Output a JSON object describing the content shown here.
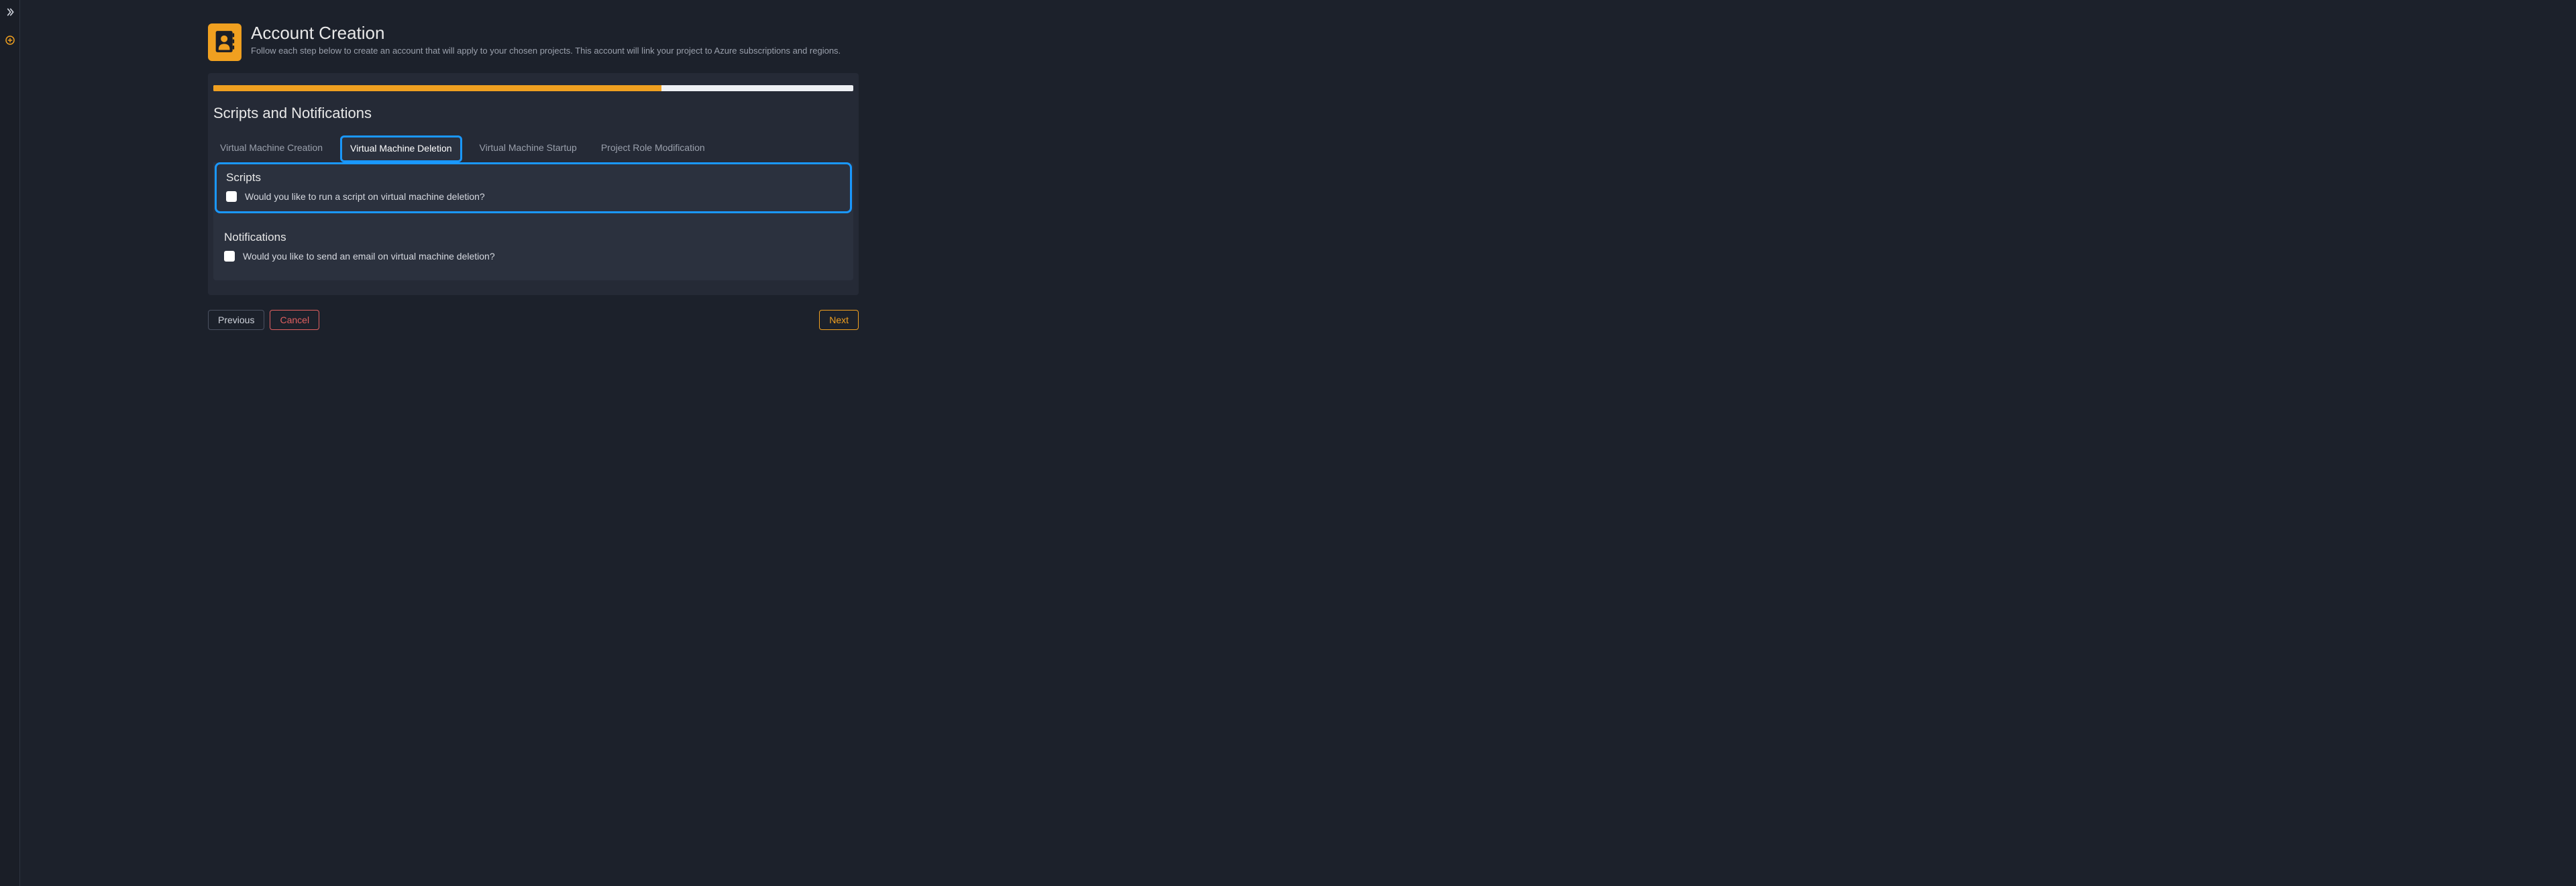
{
  "sidebar": {
    "expand_icon": "chevrons-right-icon",
    "add_icon": "plus-circle-icon"
  },
  "header": {
    "title": "Account Creation",
    "subtitle": "Follow each step below to create an account that will apply to your chosen projects. This account will link your project to Azure subscriptions and regions."
  },
  "progress": {
    "percent": 70
  },
  "section": {
    "title": "Scripts and Notifications"
  },
  "tabs": [
    {
      "label": "Virtual Machine Creation",
      "active": false
    },
    {
      "label": "Virtual Machine Deletion",
      "active": true
    },
    {
      "label": "Virtual Machine Startup",
      "active": false
    },
    {
      "label": "Project Role Modification",
      "active": false
    }
  ],
  "scripts": {
    "title": "Scripts",
    "question": "Would you like to run a script on virtual machine deletion?",
    "checked": false
  },
  "notifications": {
    "title": "Notifications",
    "question": "Would you like to send an email on virtual machine deletion?",
    "checked": false
  },
  "footer": {
    "previous": "Previous",
    "cancel": "Cancel",
    "next": "Next"
  },
  "colors": {
    "accent": "#f0a020",
    "highlight": "#1a98ff",
    "danger": "#e06060"
  }
}
